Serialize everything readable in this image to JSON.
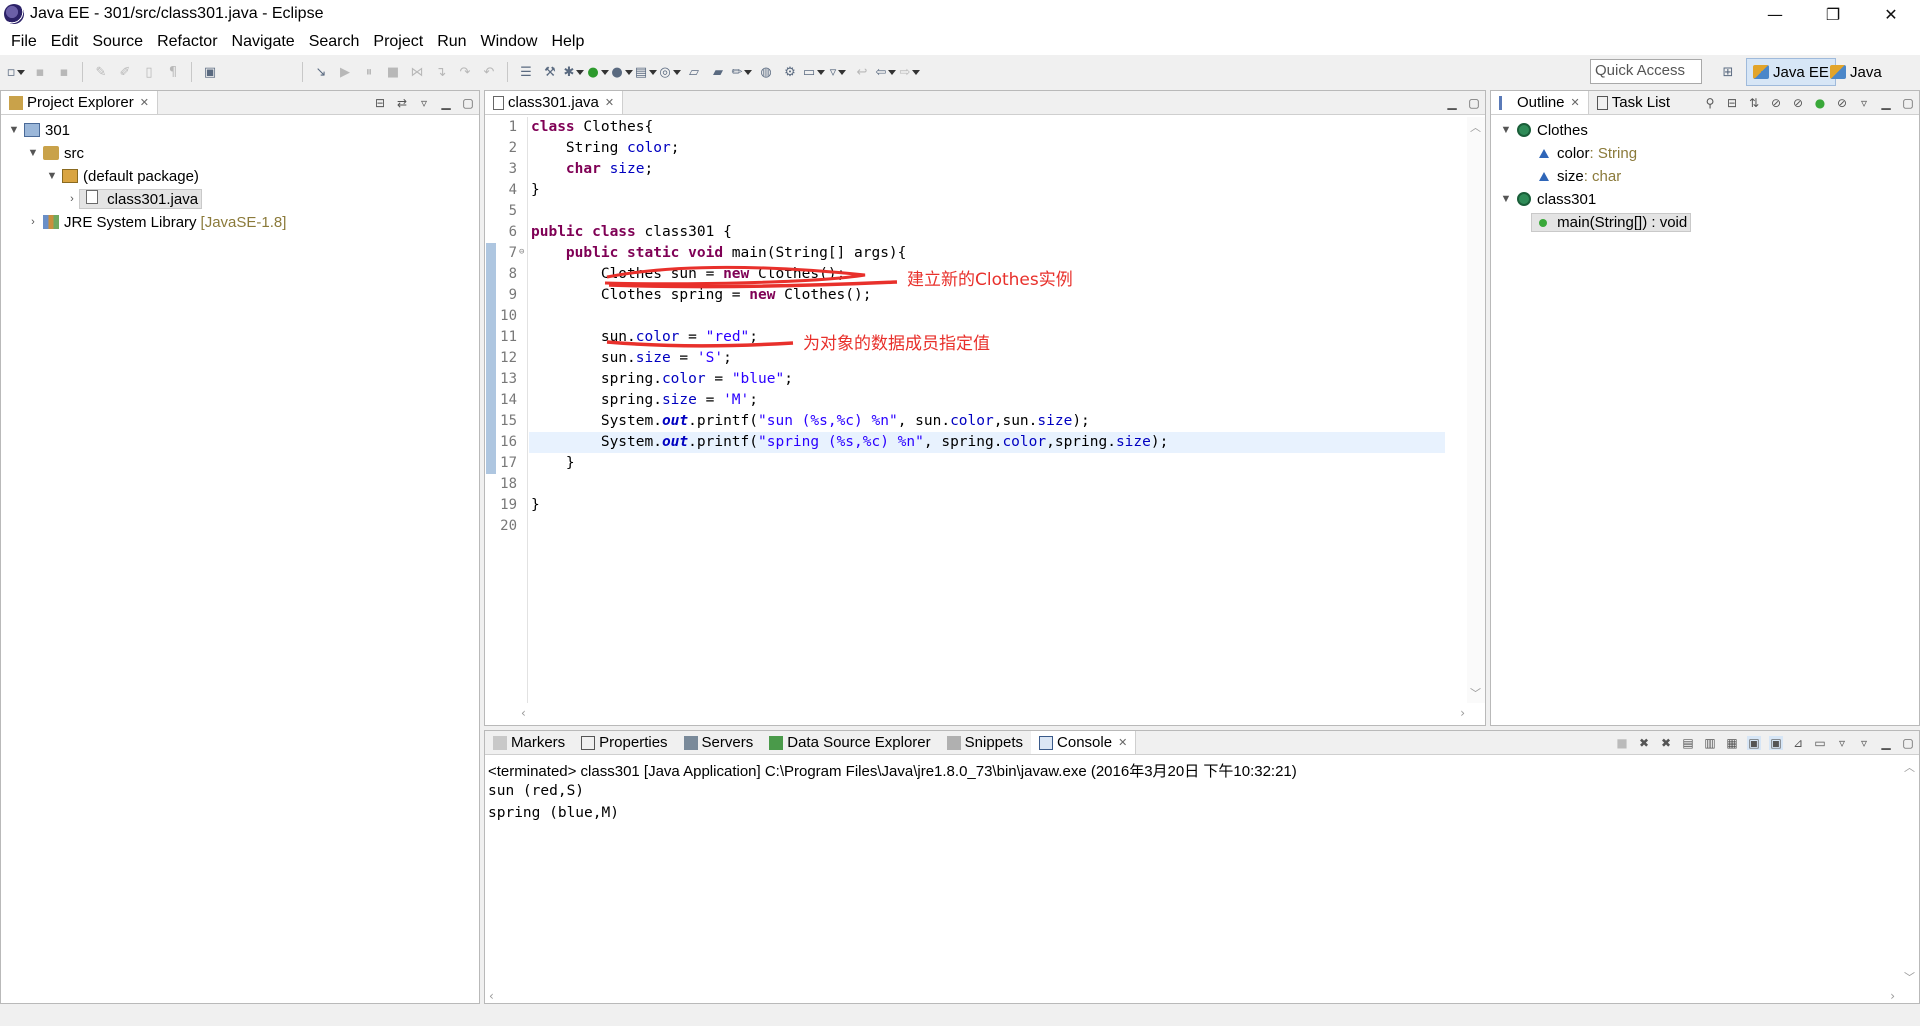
{
  "window": {
    "title": "Java EE - 301/src/class301.java - Eclipse",
    "controls": [
      "—",
      "❐",
      "✕"
    ]
  },
  "menu": [
    "File",
    "Edit",
    "Source",
    "Refactor",
    "Navigate",
    "Search",
    "Project",
    "Run",
    "Window",
    "Help"
  ],
  "toolbar": {
    "quick_access_placeholder": "Quick Access",
    "perspectives": [
      "Java EE",
      "Java"
    ]
  },
  "project_explorer": {
    "tab": "Project Explorer",
    "tree": {
      "project": "301",
      "src": "src",
      "package": "(default package)",
      "file": "class301.java",
      "library": "JRE System Library",
      "library_version": "[JavaSE-1.8]"
    }
  },
  "editor": {
    "tab": "class301.java",
    "current_line": 16,
    "lines": [
      "1",
      "2",
      "3",
      "4",
      "5",
      "6",
      "7",
      "8",
      "9",
      "10",
      "11",
      "12",
      "13",
      "14",
      "15",
      "16",
      "17",
      "18",
      "19",
      "20"
    ],
    "code": {
      "l1_kw": "class",
      "l1_rest": " Clothes{",
      "l2_type": "    String ",
      "l2_field": "color",
      "l2_end": ";",
      "l3_kw": "    char",
      "l3_sp": " ",
      "l3_field": "size",
      "l3_end": ";",
      "l4": "}",
      "l6_kw": "public class",
      "l6_rest": " class301 {",
      "l7_kw": "    public static void",
      "l7_rest": " main(String[] args){",
      "l8_a": "        Clothes sun = ",
      "l8_kw": "new",
      "l8_b": " Clothes();",
      "l9_a": "        Clothes spring = ",
      "l9_kw": "new",
      "l9_b": " Clothes();",
      "l11_a": "        sun.",
      "l11_f": "color",
      "l11_b": " = ",
      "l11_s": "\"red\"",
      "l11_c": ";",
      "l12_a": "        sun.",
      "l12_f": "size",
      "l12_b": " = ",
      "l12_s": "'S'",
      "l12_c": ";",
      "l13_a": "        spring.",
      "l13_f": "color",
      "l13_b": " = ",
      "l13_s": "\"blue\"",
      "l13_c": ";",
      "l14_a": "        spring.",
      "l14_f": "size",
      "l14_b": " = ",
      "l14_s": "'M'",
      "l14_c": ";",
      "l15_a": "        System.",
      "l15_out": "out",
      "l15_b": ".printf(",
      "l15_s": "\"sun (%s,%c) %n\"",
      "l15_c": ", sun.",
      "l15_f1": "color",
      "l15_d": ",sun.",
      "l15_f2": "size",
      "l15_e": ");",
      "l16_a": "        System.",
      "l16_out": "out",
      "l16_b": ".printf(",
      "l16_s": "\"spring (%s,%c) %n\"",
      "l16_c": ", spring.",
      "l16_f1": "color",
      "l16_d": ",spring.",
      "l16_f2": "size",
      "l16_e": ");",
      "l17": "    }",
      "l19": "}"
    },
    "annotations": {
      "a1": "建立新的Clothes实例",
      "a2": "为对象的数据成员指定值"
    }
  },
  "outline": {
    "tabs": [
      "Outline",
      "Task List"
    ],
    "items": {
      "class1": "Clothes",
      "f1_name": "color",
      "f1_type": " : String",
      "f2_name": "size",
      "f2_type": " : char",
      "class2": "class301",
      "method": "main(String[]) : void"
    }
  },
  "bottom": {
    "tabs": [
      "Markers",
      "Properties",
      "Servers",
      "Data Source Explorer",
      "Snippets",
      "Console"
    ],
    "active_tab": "Console",
    "terminated": "<terminated> class301 [Java Application] C:\\Program Files\\Java\\jre1.8.0_73\\bin\\javaw.exe (2016年3月20日 下午10:32:21)",
    "output": [
      "sun (red,S)",
      "spring (blue,M)"
    ]
  },
  "colors": {
    "keyword": "#7f0055",
    "field": "#0000c0",
    "string": "#2a00ff",
    "annotation": "#e8302b"
  }
}
